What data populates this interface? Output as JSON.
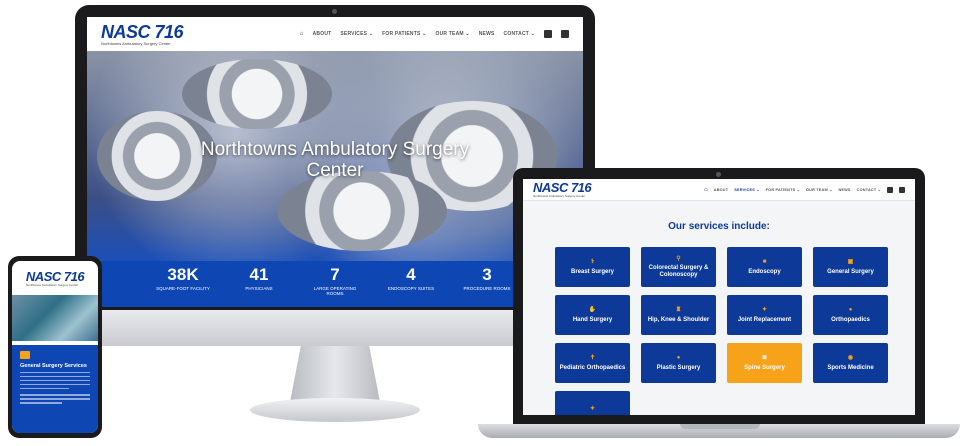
{
  "brand": {
    "logo": "NASC 716",
    "tagline": "Northtowns Ambulatory Surgery Center",
    "primary_color": "#0d3a99",
    "accent_color": "#f7a31a"
  },
  "desktop": {
    "nav": [
      "ABOUT",
      "SERVICES ⌄",
      "FOR PATIENTS ⌄",
      "OUR TEAM ⌄",
      "NEWS",
      "CONTACT ⌄"
    ],
    "hero_title_line1": "Northtowns Ambulatory Surgery",
    "hero_title_line2": "Center",
    "stats": [
      {
        "value": "38K",
        "label": "SQUARE-FOOT FACILITY"
      },
      {
        "value": "41",
        "label": "PHYSICIANS"
      },
      {
        "value": "7",
        "label": "LARGE OPERATING ROOMS"
      },
      {
        "value": "4",
        "label": "ENDOSCOPY SUITES"
      },
      {
        "value": "3",
        "label": "PROCEDURE ROOMS"
      }
    ]
  },
  "laptop": {
    "nav": [
      "ABOUT",
      "SERVICES ⌄",
      "FOR PATIENTS ⌄",
      "OUR TEAM ⌄",
      "NEWS",
      "CONTACT ⌄"
    ],
    "heading": "Our services include:",
    "services": [
      "Breast Surgery",
      "Colorectal Surgery & Colonoscopy",
      "Endoscopy",
      "General Surgery",
      "Hand Surgery",
      "Hip, Knee & Shoulder",
      "Joint Replacement",
      "Orthopaedics",
      "Pediatric Orthopaedics",
      "Plastic Surgery",
      "Spine Surgery",
      "Sports Medicine"
    ],
    "highlighted_service": "Spine Surgery"
  },
  "phone": {
    "card_title": "General Surgery Services"
  }
}
